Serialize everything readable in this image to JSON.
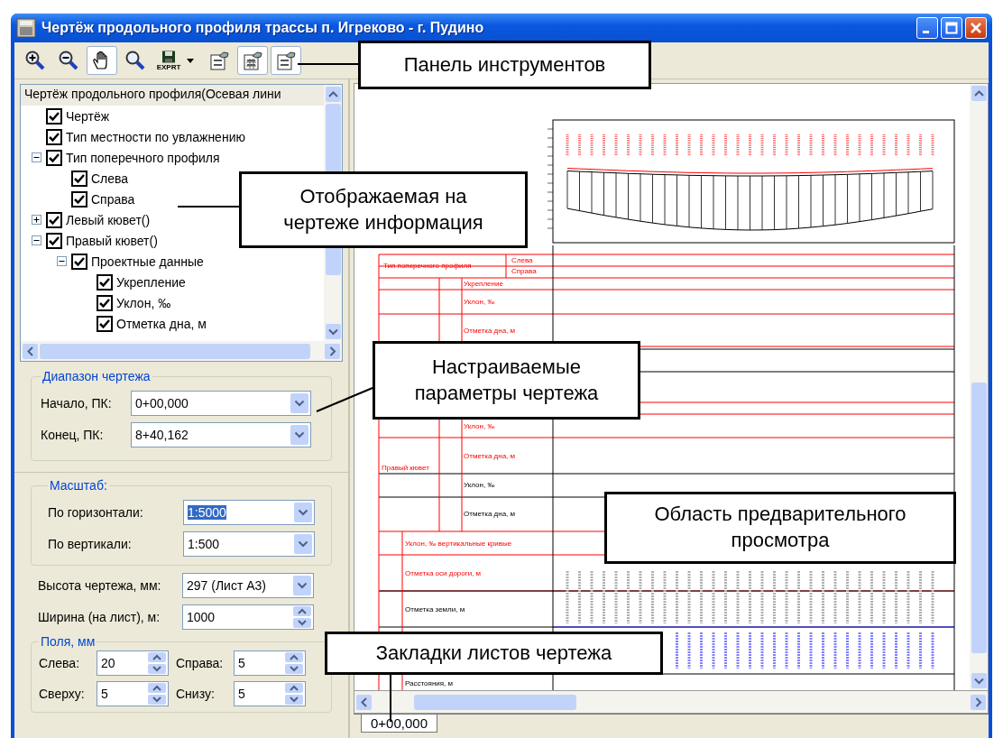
{
  "window": {
    "title": "Чертёж продольного профиля трассы п. Игреково - г. Пудино"
  },
  "toolbar": [
    {
      "pressed": false
    },
    {
      "pressed": false
    },
    {
      "pressed": true
    },
    {
      "pressed": false
    },
    {
      "label": "EXPRT",
      "pressed": false,
      "dropdown": true
    },
    {
      "pressed": false
    },
    {
      "pressed": true
    },
    {
      "pressed": true
    }
  ],
  "tree": {
    "root": "Чертёж продольного профиля(Осевая лини",
    "items": [
      {
        "label": "Чертёж",
        "checked": true
      },
      {
        "label": "Тип местности по увлажнению",
        "checked": true
      },
      {
        "label": "Тип поперечного профиля",
        "checked": true,
        "expanded": true,
        "children": [
          {
            "label": "Слева",
            "checked": true
          },
          {
            "label": "Справа",
            "checked": true
          }
        ]
      },
      {
        "label": "Левый кювет()",
        "checked": true,
        "expanded": false
      },
      {
        "label": "Правый кювет()",
        "checked": true,
        "expanded": true,
        "children": [
          {
            "label": "Проектные данные",
            "checked": true,
            "expanded": true,
            "children": [
              {
                "label": "Укрепление",
                "checked": true
              },
              {
                "label": "Уклон, ‰",
                "checked": true
              },
              {
                "label": "Отметка дна, м",
                "checked": true
              }
            ]
          }
        ]
      }
    ]
  },
  "range": {
    "legend": "Диапазон чертежа",
    "fields": [
      {
        "label": "Начало, ПК:",
        "value": "0+00,000"
      },
      {
        "label": "Конец, ПК:",
        "value": "8+40,162"
      }
    ]
  },
  "scale": {
    "legend": "Масштаб:",
    "fields": [
      {
        "label": "По горизонтали:",
        "value": "1:5000",
        "highlighted": true
      },
      {
        "label": "По вертикали:",
        "value": "1:500",
        "highlighted": false
      }
    ]
  },
  "size_fields": [
    {
      "kind": "dropdown",
      "label": "Высота чертежа, мм:",
      "value": "297 (Лист А3)"
    },
    {
      "kind": "spinner",
      "label": "Ширина (на лист), м:",
      "value": "1000"
    }
  ],
  "margins": {
    "legend": "Поля, мм",
    "fields": [
      {
        "label": "Слева:",
        "value": "20"
      },
      {
        "label": "Справа:",
        "value": "5"
      },
      {
        "label": "Сверху:",
        "value": "5"
      },
      {
        "label": "Снизу:",
        "value": "5"
      }
    ]
  },
  "preview": {
    "row_labels": [
      {
        "text": "Тип поперечного профиля",
        "kind": "design"
      },
      {
        "text": "Слева",
        "kind": "design"
      },
      {
        "text": "Справа",
        "kind": "design"
      },
      {
        "text": "Укрепление",
        "kind": "design"
      },
      {
        "text": "Уклон, ‰",
        "kind": "design"
      },
      {
        "text": "Отметка дна, м",
        "kind": "design"
      },
      {
        "text": "Уклон, ‰",
        "kind": "design"
      },
      {
        "text": "Отметка дна, м",
        "kind": "design"
      },
      {
        "text": "Правый кювет",
        "kind": "design"
      },
      {
        "text": "Уклон, ‰",
        "kind": "actual"
      },
      {
        "text": "Отметка дна, м",
        "kind": "actual"
      },
      {
        "text": "Уклон, ‰ вертикальные кривые",
        "kind": "design"
      },
      {
        "text": "Отметка оси дороги, м",
        "kind": "design"
      },
      {
        "text": "Отметка земли, м",
        "kind": "actual"
      },
      {
        "text": "Расстояния, м",
        "kind": "actual"
      }
    ]
  },
  "sheet_tabs": [
    {
      "label": "0+00,000",
      "selected": true
    }
  ],
  "callouts": [
    {
      "text": "Панель инструментов"
    },
    {
      "text": "Отображаемая на\nчертеже информация"
    },
    {
      "text": "Настраиваемые\nпараметры чертежа"
    },
    {
      "text": "Область предварительного\nпросмотра"
    },
    {
      "text": "Закладки листов чертежа"
    }
  ]
}
